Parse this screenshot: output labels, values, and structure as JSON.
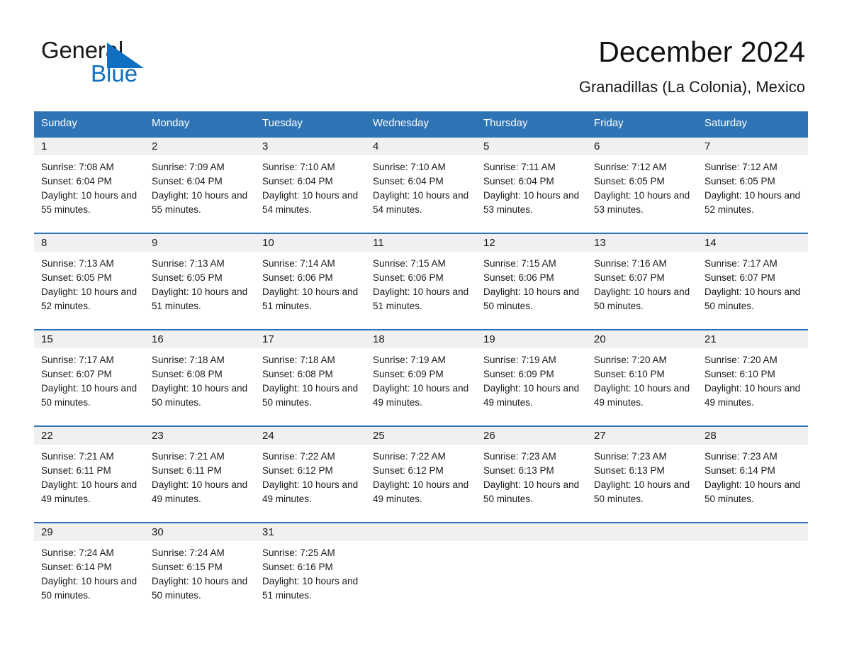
{
  "brand": {
    "name_part1": "General",
    "name_part2": "Blue",
    "logo_icon": "triangle-logo-icon",
    "accent_color": "#0f6fc2"
  },
  "header": {
    "month_title": "December 2024",
    "location": "Granadillas (La Colonia), Mexico"
  },
  "calendar": {
    "header_color": "#2e74b5",
    "daynum_band_color": "#f0f0f0",
    "weekdays": [
      "Sunday",
      "Monday",
      "Tuesday",
      "Wednesday",
      "Thursday",
      "Friday",
      "Saturday"
    ],
    "weeks": [
      [
        {
          "day": "1",
          "sunrise": "Sunrise: 7:08 AM",
          "sunset": "Sunset: 6:04 PM",
          "daylight": "Daylight: 10 hours and 55 minutes."
        },
        {
          "day": "2",
          "sunrise": "Sunrise: 7:09 AM",
          "sunset": "Sunset: 6:04 PM",
          "daylight": "Daylight: 10 hours and 55 minutes."
        },
        {
          "day": "3",
          "sunrise": "Sunrise: 7:10 AM",
          "sunset": "Sunset: 6:04 PM",
          "daylight": "Daylight: 10 hours and 54 minutes."
        },
        {
          "day": "4",
          "sunrise": "Sunrise: 7:10 AM",
          "sunset": "Sunset: 6:04 PM",
          "daylight": "Daylight: 10 hours and 54 minutes."
        },
        {
          "day": "5",
          "sunrise": "Sunrise: 7:11 AM",
          "sunset": "Sunset: 6:04 PM",
          "daylight": "Daylight: 10 hours and 53 minutes."
        },
        {
          "day": "6",
          "sunrise": "Sunrise: 7:12 AM",
          "sunset": "Sunset: 6:05 PM",
          "daylight": "Daylight: 10 hours and 53 minutes."
        },
        {
          "day": "7",
          "sunrise": "Sunrise: 7:12 AM",
          "sunset": "Sunset: 6:05 PM",
          "daylight": "Daylight: 10 hours and 52 minutes."
        }
      ],
      [
        {
          "day": "8",
          "sunrise": "Sunrise: 7:13 AM",
          "sunset": "Sunset: 6:05 PM",
          "daylight": "Daylight: 10 hours and 52 minutes."
        },
        {
          "day": "9",
          "sunrise": "Sunrise: 7:13 AM",
          "sunset": "Sunset: 6:05 PM",
          "daylight": "Daylight: 10 hours and 51 minutes."
        },
        {
          "day": "10",
          "sunrise": "Sunrise: 7:14 AM",
          "sunset": "Sunset: 6:06 PM",
          "daylight": "Daylight: 10 hours and 51 minutes."
        },
        {
          "day": "11",
          "sunrise": "Sunrise: 7:15 AM",
          "sunset": "Sunset: 6:06 PM",
          "daylight": "Daylight: 10 hours and 51 minutes."
        },
        {
          "day": "12",
          "sunrise": "Sunrise: 7:15 AM",
          "sunset": "Sunset: 6:06 PM",
          "daylight": "Daylight: 10 hours and 50 minutes."
        },
        {
          "day": "13",
          "sunrise": "Sunrise: 7:16 AM",
          "sunset": "Sunset: 6:07 PM",
          "daylight": "Daylight: 10 hours and 50 minutes."
        },
        {
          "day": "14",
          "sunrise": "Sunrise: 7:17 AM",
          "sunset": "Sunset: 6:07 PM",
          "daylight": "Daylight: 10 hours and 50 minutes."
        }
      ],
      [
        {
          "day": "15",
          "sunrise": "Sunrise: 7:17 AM",
          "sunset": "Sunset: 6:07 PM",
          "daylight": "Daylight: 10 hours and 50 minutes."
        },
        {
          "day": "16",
          "sunrise": "Sunrise: 7:18 AM",
          "sunset": "Sunset: 6:08 PM",
          "daylight": "Daylight: 10 hours and 50 minutes."
        },
        {
          "day": "17",
          "sunrise": "Sunrise: 7:18 AM",
          "sunset": "Sunset: 6:08 PM",
          "daylight": "Daylight: 10 hours and 50 minutes."
        },
        {
          "day": "18",
          "sunrise": "Sunrise: 7:19 AM",
          "sunset": "Sunset: 6:09 PM",
          "daylight": "Daylight: 10 hours and 49 minutes."
        },
        {
          "day": "19",
          "sunrise": "Sunrise: 7:19 AM",
          "sunset": "Sunset: 6:09 PM",
          "daylight": "Daylight: 10 hours and 49 minutes."
        },
        {
          "day": "20",
          "sunrise": "Sunrise: 7:20 AM",
          "sunset": "Sunset: 6:10 PM",
          "daylight": "Daylight: 10 hours and 49 minutes."
        },
        {
          "day": "21",
          "sunrise": "Sunrise: 7:20 AM",
          "sunset": "Sunset: 6:10 PM",
          "daylight": "Daylight: 10 hours and 49 minutes."
        }
      ],
      [
        {
          "day": "22",
          "sunrise": "Sunrise: 7:21 AM",
          "sunset": "Sunset: 6:11 PM",
          "daylight": "Daylight: 10 hours and 49 minutes."
        },
        {
          "day": "23",
          "sunrise": "Sunrise: 7:21 AM",
          "sunset": "Sunset: 6:11 PM",
          "daylight": "Daylight: 10 hours and 49 minutes."
        },
        {
          "day": "24",
          "sunrise": "Sunrise: 7:22 AM",
          "sunset": "Sunset: 6:12 PM",
          "daylight": "Daylight: 10 hours and 49 minutes."
        },
        {
          "day": "25",
          "sunrise": "Sunrise: 7:22 AM",
          "sunset": "Sunset: 6:12 PM",
          "daylight": "Daylight: 10 hours and 49 minutes."
        },
        {
          "day": "26",
          "sunrise": "Sunrise: 7:23 AM",
          "sunset": "Sunset: 6:13 PM",
          "daylight": "Daylight: 10 hours and 50 minutes."
        },
        {
          "day": "27",
          "sunrise": "Sunrise: 7:23 AM",
          "sunset": "Sunset: 6:13 PM",
          "daylight": "Daylight: 10 hours and 50 minutes."
        },
        {
          "day": "28",
          "sunrise": "Sunrise: 7:23 AM",
          "sunset": "Sunset: 6:14 PM",
          "daylight": "Daylight: 10 hours and 50 minutes."
        }
      ],
      [
        {
          "day": "29",
          "sunrise": "Sunrise: 7:24 AM",
          "sunset": "Sunset: 6:14 PM",
          "daylight": "Daylight: 10 hours and 50 minutes."
        },
        {
          "day": "30",
          "sunrise": "Sunrise: 7:24 AM",
          "sunset": "Sunset: 6:15 PM",
          "daylight": "Daylight: 10 hours and 50 minutes."
        },
        {
          "day": "31",
          "sunrise": "Sunrise: 7:25 AM",
          "sunset": "Sunset: 6:16 PM",
          "daylight": "Daylight: 10 hours and 51 minutes."
        },
        {
          "day": "",
          "sunrise": "",
          "sunset": "",
          "daylight": ""
        },
        {
          "day": "",
          "sunrise": "",
          "sunset": "",
          "daylight": ""
        },
        {
          "day": "",
          "sunrise": "",
          "sunset": "",
          "daylight": ""
        },
        {
          "day": "",
          "sunrise": "",
          "sunset": "",
          "daylight": ""
        }
      ]
    ]
  }
}
